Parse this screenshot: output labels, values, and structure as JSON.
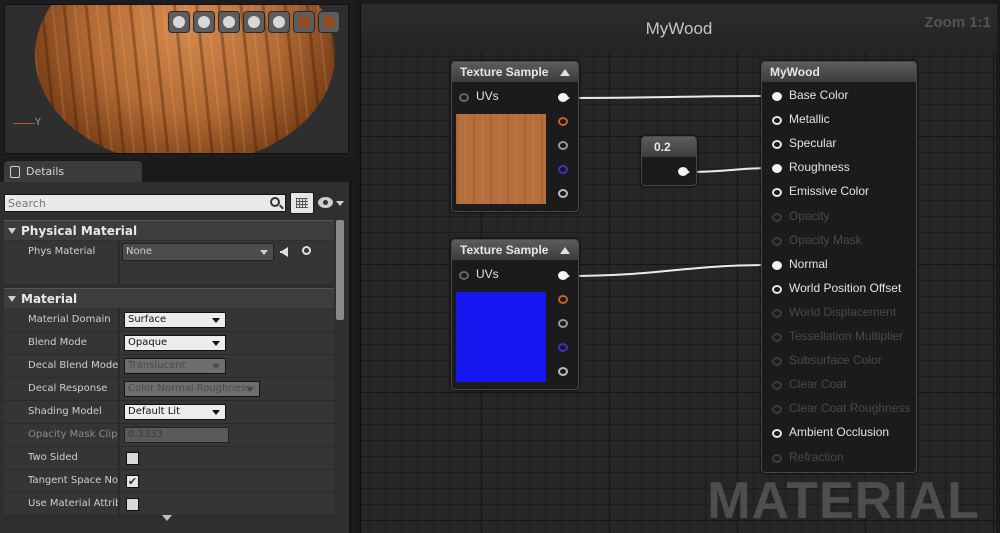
{
  "viewport": {
    "axis_label": "Y",
    "toolbar_icons": [
      "cylinder-icon",
      "sphere-icon",
      "plane-icon",
      "cube-icon",
      "mesh-icon",
      "grid-icon",
      "realtime-icon"
    ]
  },
  "details": {
    "tab_label": "Details",
    "search_placeholder": "Search",
    "physical_material": {
      "header": "Physical Material",
      "phys_material_label": "Phys Material",
      "phys_material_value": "None"
    },
    "material": {
      "header": "Material",
      "material_domain": {
        "label": "Material Domain",
        "value": "Surface"
      },
      "blend_mode": {
        "label": "Blend Mode",
        "value": "Opaque"
      },
      "decal_blend_mode": {
        "label": "Decal Blend Mode",
        "value": "Translucent"
      },
      "decal_response": {
        "label": "Decal Response",
        "value": "Color Normal Roughness"
      },
      "shading_model": {
        "label": "Shading Model",
        "value": "Default Lit"
      },
      "opacity_mask_clip": {
        "label": "Opacity Mask Clip",
        "value": "0.3333"
      },
      "two_sided": {
        "label": "Two Sided",
        "checked": false
      },
      "tangent_space_normal": {
        "label": "Tangent Space Nor",
        "checked": true
      },
      "use_material_attributes": {
        "label": "Use Material Attrib",
        "checked": false
      }
    }
  },
  "graph": {
    "title": "MyWood",
    "zoom": "Zoom 1:1",
    "watermark": "MATERIAL",
    "texture_sample_1": {
      "title": "Texture Sample",
      "uv_label": "UVs",
      "swatch_color": "#b56f3e"
    },
    "texture_sample_2": {
      "title": "Texture Sample",
      "uv_label": "UVs",
      "swatch_color": "#1616f0"
    },
    "constant": {
      "value": "0.2"
    },
    "material_node": {
      "title": "MyWood",
      "inputs": [
        {
          "label": "Base Color",
          "enabled": true,
          "connected": true
        },
        {
          "label": "Metallic",
          "enabled": true,
          "connected": false
        },
        {
          "label": "Specular",
          "enabled": true,
          "connected": false
        },
        {
          "label": "Roughness",
          "enabled": true,
          "connected": true
        },
        {
          "label": "Emissive Color",
          "enabled": true,
          "connected": false
        },
        {
          "label": "Opacity",
          "enabled": false,
          "connected": false
        },
        {
          "label": "Opacity Mask",
          "enabled": false,
          "connected": false
        },
        {
          "label": "Normal",
          "enabled": true,
          "connected": true
        },
        {
          "label": "World Position Offset",
          "enabled": true,
          "connected": false
        },
        {
          "label": "World Displacement",
          "enabled": false,
          "connected": false
        },
        {
          "label": "Tessellation Multiplier",
          "enabled": false,
          "connected": false
        },
        {
          "label": "Subsurface Color",
          "enabled": false,
          "connected": false
        },
        {
          "label": "Clear Coat",
          "enabled": false,
          "connected": false
        },
        {
          "label": "Clear Coat Roughness",
          "enabled": false,
          "connected": false
        },
        {
          "label": "Ambient Occlusion",
          "enabled": true,
          "connected": false
        },
        {
          "label": "Refraction",
          "enabled": false,
          "connected": false
        }
      ]
    }
  }
}
